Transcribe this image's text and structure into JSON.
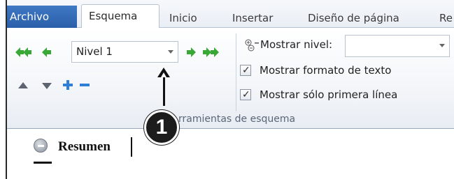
{
  "tabs": {
    "file": "Archivo",
    "active": "Esquema",
    "items": [
      "Inicio",
      "Insertar",
      "Diseño de página",
      "Re"
    ]
  },
  "ribbon": {
    "level_dropdown_value": "Nivel 1",
    "show_level_label": "Mostrar nivel:",
    "show_text_format_label": "Mostrar formato de texto",
    "show_first_line_label": "Mostrar sólo primera línea",
    "group_label": "rramientas de esquema",
    "show_text_format_checked": true,
    "show_first_line_checked": true
  },
  "document": {
    "heading": "Resumen"
  },
  "callout": {
    "number": "1"
  },
  "colors": {
    "file_tab": "#2b5fa8",
    "arrow_green": "#3aa836",
    "arrow_blue": "#2f7fd6",
    "callout": "#1c1c1c"
  },
  "icons": {
    "promote_to_heading1": "double-left-green-arrow-icon",
    "promote": "left-green-arrow-icon",
    "demote": "right-green-arrow-icon",
    "demote_to_body": "double-right-green-arrow-icon",
    "move_up": "triangle-up-icon",
    "move_down": "triangle-down-icon",
    "expand": "plus-icon",
    "collapse": "minus-icon",
    "show_level": "show-level-icon",
    "heading_collapse": "minus-circle-icon"
  }
}
